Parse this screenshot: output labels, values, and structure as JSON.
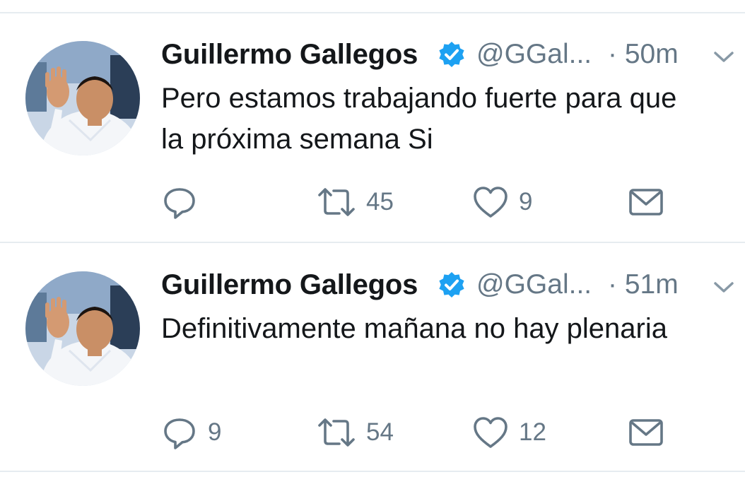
{
  "colors": {
    "text_primary": "#14171a",
    "text_secondary": "#657786",
    "verified_blue": "#1da1f2",
    "divider": "#e6ecf0"
  },
  "tweets": [
    {
      "author_name": "Guillermo Gallegos",
      "handle": "@GGal...",
      "time": "· 50m",
      "text_lines": [
        "Pero estamos trabajando fuerte para que",
        "la próxima semana Si"
      ],
      "reply_count": "",
      "retweet_count": "45",
      "like_count": "9",
      "icons": [
        "reply-icon",
        "retweet-icon",
        "like-icon",
        "message-icon"
      ]
    },
    {
      "author_name": "Guillermo Gallegos",
      "handle": "@GGal...",
      "time": "· 51m",
      "text_lines": [
        "Definitivamente mañana no hay plenaria"
      ],
      "reply_count": "9",
      "retweet_count": "54",
      "like_count": "12",
      "icons": [
        "reply-icon",
        "retweet-icon",
        "like-icon",
        "message-icon"
      ]
    }
  ]
}
